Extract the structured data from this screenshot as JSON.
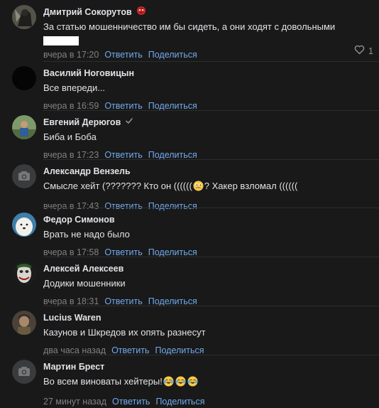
{
  "colors": {
    "background": "#19191a",
    "text": "#e1e3e6",
    "meta": "#828282",
    "link": "#71aaeb",
    "divider": "#2c2d2e"
  },
  "actions": {
    "reply": "Ответить",
    "share": "Поделиться"
  },
  "comments": [
    {
      "author": "Дмитрий Сокорутов",
      "badge": "spider-icon",
      "text": "За статью мошенничество им бы сидеть, а они ходят с довольными",
      "time": "вчера в 17:20",
      "likes": "1",
      "avatar": "photo-dark-figure"
    },
    {
      "author": "Василий Ноговицын",
      "text": "Все впереди...",
      "time": "вчера в 16:59",
      "avatar": "photo-black"
    },
    {
      "author": "Евгений Дерюгов",
      "badge": "verified-check-icon",
      "text": "Биба и Боба",
      "time": "вчера в 17:23",
      "avatar": "photo-outdoor"
    },
    {
      "author": "Александр Вензель",
      "text_parts": [
        "Смысле хейт (??????? Кто он ((((((",
        "? Хакер взломал (((((("
      ],
      "emoji": "thinking-face-emoji",
      "time": "вчера в 17:43",
      "avatar": "camera-placeholder-icon"
    },
    {
      "author": "Федор Симонов",
      "text": "Врать не надо было",
      "time": "вчера в 17:58",
      "avatar": "photo-white-dog"
    },
    {
      "author": "Алексей Алексеев",
      "text": "Додики мошенники",
      "time": "вчера в 18:31",
      "avatar": "photo-joker-face"
    },
    {
      "author": "Lucius Waren",
      "text": "Казунов и Шкредов их опять разнесут",
      "time": "два часа назад",
      "avatar": "photo-portrait"
    },
    {
      "author": "Мартин Брест",
      "text": "Во всем виноваты хейтеры!",
      "emoji": "tears-of-joy-emoji",
      "time": "27 минут назад",
      "avatar": "camera-placeholder-icon"
    }
  ]
}
